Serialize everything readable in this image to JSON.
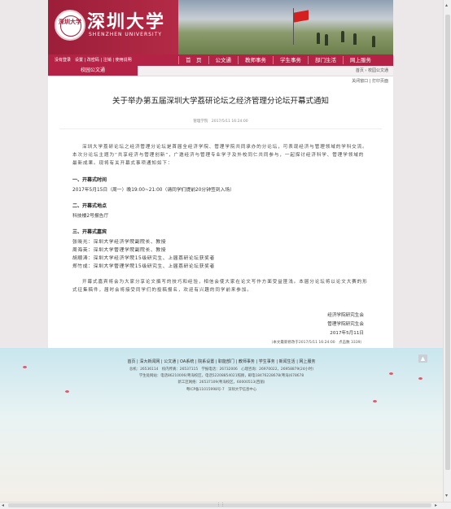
{
  "header": {
    "seal_text": "深圳大学",
    "university_cn": "深圳大学",
    "university_en": "SHENZHEN UNIVERSITY",
    "login_text": "没有登录　设置 | 改密码 | 注销 | 使用说明"
  },
  "nav": {
    "items": [
      "首　页",
      "公文通",
      "教师事务",
      "学生事务",
      "部门生活",
      "网上服务"
    ]
  },
  "subbar": {
    "section_title": "校园公文通",
    "breadcrumb": "首页 › 校园公文通",
    "tools": "关闭窗口 | 打印页面"
  },
  "article": {
    "title": "关于举办第五届深圳大学荔研论坛之经济管理分论坛开幕式通知",
    "meta": "管理学院　2017/5/11 16:24:00",
    "intro": "深圳大学荔研论坛之经济管理分论坛是首届全经济学院、管理学院共同承办的分论坛，可表现经济与管理领域的学科交流。本次分论坛主题为“共享经济与管理创新”，广邀经济与管理专业学子及外校同仁共同参与，一起探讨经济科学、管理学领域的最新成果。现将有关开幕式事项通知如下：",
    "section1_heading": "一、开幕式时间",
    "section1_text": "2017年5月15日（周一）晚19:00~21:00（请同学们提前20分钟签到入场）",
    "section2_heading": "二、开幕式地点",
    "section2_text": "科技楼2号报告厅",
    "section3_heading": "三、开幕式嘉宾",
    "guests": [
      "张晓光：深圳大学经济学院副院长、教授",
      "周海英：深圳大学管理学院副院长、教授",
      "胡顺涛：深圳大学经济学院15级研究生、上届荔研论坛获奖者",
      "郑竹成：深圳大学管理学院15级研究生、上届荔研论坛获奖者"
    ],
    "closing": "开幕式嘉宾将会为大家分享论文撰写的技巧和经验，相信会使大家在论文写作方面受益匪浅。本届分论坛将以论文大赛的形式征集稿件，届时会将接受同学们的投稿报名，欢迎有兴趣的同学前来参加。",
    "sign_1": "经济学院研究生会",
    "sign_2": "管理学院研究生会",
    "sign_date": "2017年5月11日",
    "updated": "（本文最新修改于2017/5/11 16:24:00　点击数 3339）"
  },
  "footer": {
    "links": "首页 | 深大新闻网 | 公文通 | OA系统 | 院系设置 | 职能部门 | 教师事务 | 学生事务 | 新闻生活 | 网上服务",
    "line1": "总机：26536114　校内传真：26537115　学报电话：26732006　心理咨询：26970022，26958879(24小时)",
    "line2": "学生处网站：电话86210006(粤海校区，电话52208854021照顾，邮电18476228678(粤海)678678",
    "line3": "新工区网络：26537109(粤海校区，60000513(西丽)",
    "line4": "粤ICP备11015998号-7　深圳大学信息中心"
  },
  "colors": {
    "brand_red": "#b42346",
    "footer_sky": "#c9e6ee"
  }
}
